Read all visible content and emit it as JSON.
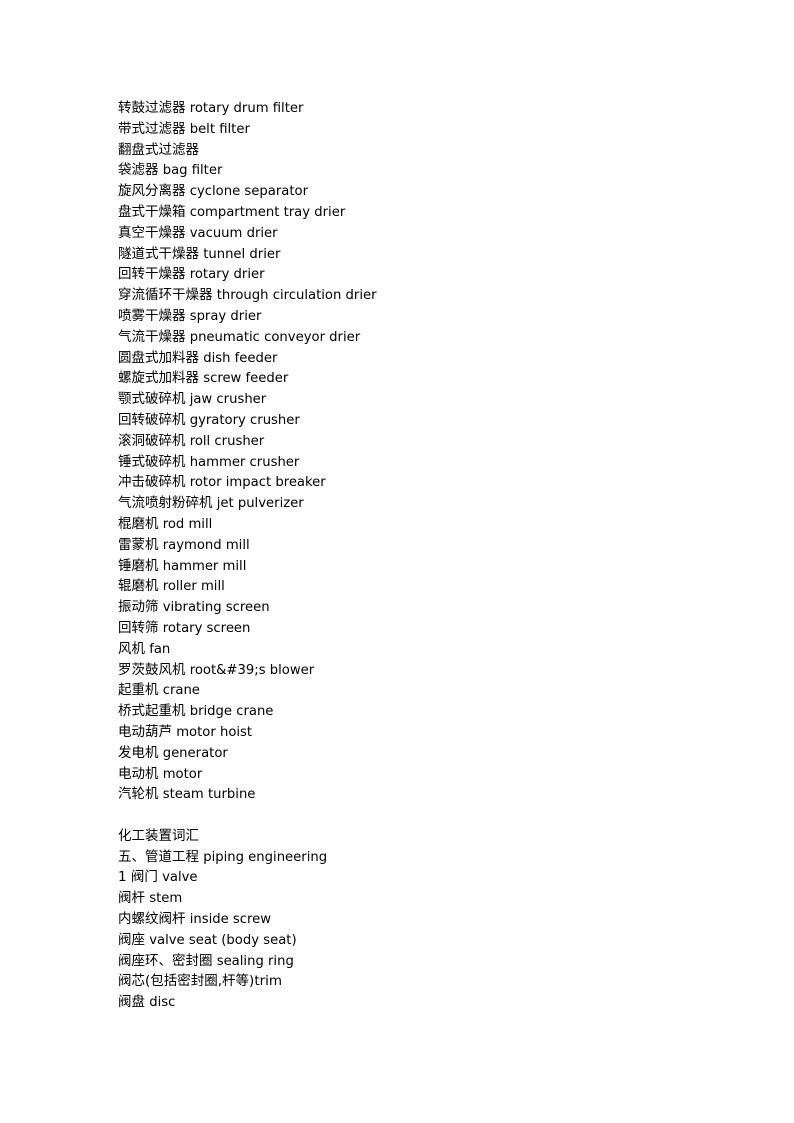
{
  "document": {
    "title": "化工装置词汇",
    "page_background": "#ffffff",
    "text_color": "#000000",
    "lines": [
      {
        "cn": "转鼓过滤器",
        "en": " rotary drum filter"
      },
      {
        "cn": "带式过滤器",
        "en": " belt filter"
      },
      {
        "cn": "翻盘式过滤器",
        "en": ""
      },
      {
        "cn": "袋滤器",
        "en": " bag filter"
      },
      {
        "cn": "旋风分离器",
        "en": " cyclone separator"
      },
      {
        "cn": "盘式干燥箱",
        "en": " compartment tray drier"
      },
      {
        "cn": "真空干燥器",
        "en": " vacuum drier"
      },
      {
        "cn": "隧道式干燥器",
        "en": " tunnel drier"
      },
      {
        "cn": "回转干燥器",
        "en": " rotary drier"
      },
      {
        "cn": "穿流循环干燥器",
        "en": " through circulation drier"
      },
      {
        "cn": "喷雾干燥器",
        "en": " spray drier"
      },
      {
        "cn": "气流干燥器",
        "en": " pneumatic conveyor drier"
      },
      {
        "cn": "圆盘式加料器",
        "en": " dish feeder"
      },
      {
        "cn": "螺旋式加料器",
        "en": " screw feeder"
      },
      {
        "cn": "颚式破碎机",
        "en": " jaw crusher"
      },
      {
        "cn": "回转破碎机",
        "en": " gyratory crusher"
      },
      {
        "cn": "滚洞破碎机",
        "en": " roll crusher"
      },
      {
        "cn": "锤式破碎机",
        "en": " hammer crusher"
      },
      {
        "cn": "冲击破碎机",
        "en": " rotor impact breaker"
      },
      {
        "cn": "气流喷射粉碎机",
        "en": " jet pulverizer"
      },
      {
        "cn": "棍磨机",
        "en": " rod mill"
      },
      {
        "cn": "雷蒙机",
        "en": " raymond mill"
      },
      {
        "cn": "锤磨机",
        "en": " hammer mill"
      },
      {
        "cn": "辊磨机",
        "en": " roller mill"
      },
      {
        "cn": "振动筛",
        "en": " vibrating screen"
      },
      {
        "cn": "回转筛",
        "en": " rotary screen"
      },
      {
        "cn": "风机",
        "en": " fan"
      },
      {
        "cn": "罗茨鼓风机",
        "en": " root&#39;s blower"
      },
      {
        "cn": "起重机",
        "en": " crane"
      },
      {
        "cn": "桥式起重机",
        "en": " bridge crane"
      },
      {
        "cn": "电动葫芦",
        "en": " motor hoist"
      },
      {
        "cn": "发电机",
        "en": " generator"
      },
      {
        "cn": "电动机",
        "en": " motor"
      },
      {
        "cn": "汽轮机",
        "en": " steam turbine"
      },
      {
        "cn": "",
        "en": ""
      },
      {
        "cn": "化工装置词汇",
        "en": ""
      },
      {
        "cn": "五、管道工程",
        "en": " piping engineering"
      },
      {
        "cn": "1 阀门",
        "en": " valve"
      },
      {
        "cn": "阀杆",
        "en": " stem"
      },
      {
        "cn": "内螺纹阀杆",
        "en": " inside screw"
      },
      {
        "cn": "阀座",
        "en": " valve seat (body seat)"
      },
      {
        "cn": "阀座环、密封圈",
        "en": " sealing ring"
      },
      {
        "cn": "阀芯(包括密封圈,杆等)trim",
        "en": ""
      },
      {
        "cn": "阀盘",
        "en": " disc"
      }
    ]
  }
}
